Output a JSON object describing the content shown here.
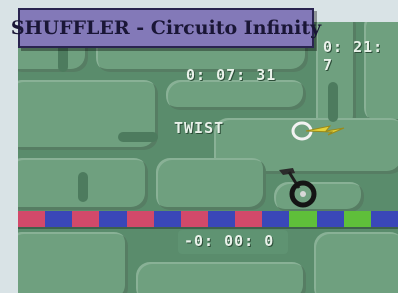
{
  "title": "SHUFFLER - Circuito Infinity",
  "hud": {
    "timer_top_right": "0: 21: 7",
    "timer_main": "0: 07: 31",
    "trick_label": "TWIST",
    "timer_bottom": "-0: 00: 0"
  },
  "track": {
    "segments": [
      "red",
      "blue",
      "red",
      "blue",
      "red",
      "blue",
      "red",
      "blue",
      "red",
      "blue",
      "green",
      "blue",
      "green",
      "blue"
    ],
    "colors": {
      "red": "#d2496a",
      "blue": "#3a47b8",
      "green": "#5fbf3a"
    }
  },
  "colors": {
    "banner": "#8379b8",
    "board": "#5a8c6c",
    "slab": "#6fa07f"
  },
  "icons": [
    "unicycle-icon",
    "spark-icon"
  ]
}
